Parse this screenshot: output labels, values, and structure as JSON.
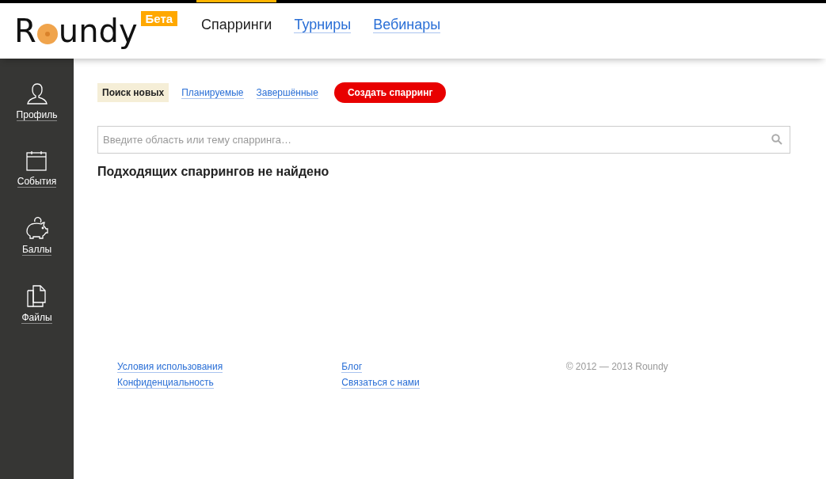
{
  "header": {
    "logo_start": "R",
    "logo_end": "undy",
    "badge": "Бета",
    "nav": [
      {
        "label": "Спарринги",
        "selected": true
      },
      {
        "label": "Турниры",
        "selected": false
      },
      {
        "label": "Вебинары",
        "selected": false
      }
    ]
  },
  "sidebar": {
    "items": [
      {
        "kind": "user",
        "label": "Профиль"
      },
      {
        "kind": "calendar",
        "label": "События"
      },
      {
        "kind": "piggy",
        "label": "Баллы"
      },
      {
        "kind": "files",
        "label": "Файлы"
      }
    ]
  },
  "filters": [
    {
      "label": "Поиск новых",
      "selected": true
    },
    {
      "label": "Планируемые",
      "selected": false
    },
    {
      "label": "Завершённые",
      "selected": false
    }
  ],
  "create_button": "Создать спарринг",
  "search": {
    "placeholder": "Введите область или тему спарринга…"
  },
  "empty_message": "Подходящих спаррингов не найдено",
  "footer": {
    "columns": [
      [
        "Условия использования",
        "Конфиденциальность"
      ],
      [
        "Блог",
        "Связаться с нами"
      ]
    ],
    "copyright": "© 2012 — 2013 Roundy"
  }
}
